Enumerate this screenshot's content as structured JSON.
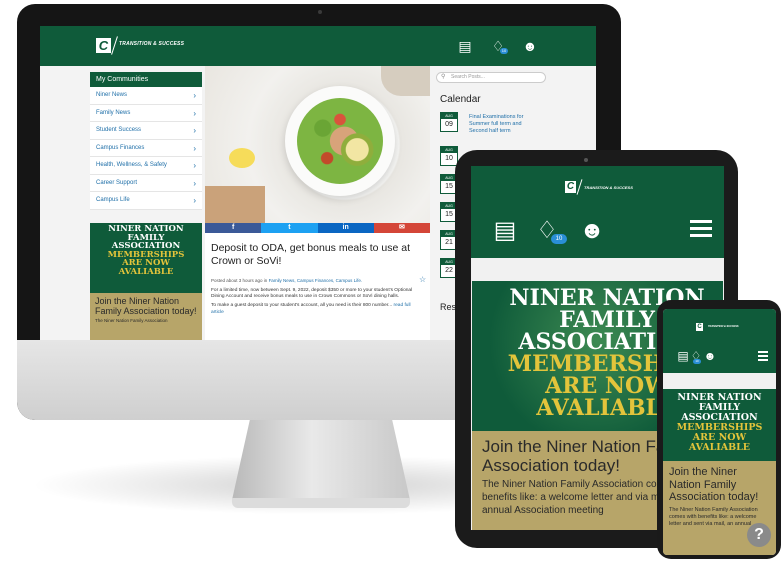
{
  "brand": {
    "logo_letter": "C",
    "logo_text": "TRANSITION & SUCCESS",
    "green": "#0f5b3a",
    "gold": "#e3c43b",
    "tan": "#b7a569"
  },
  "desktop": {
    "header_icons": [
      "newspaper-icon",
      "bell-icon",
      "user-icon"
    ],
    "notification_count": "10",
    "sidebar": {
      "title": "My Communities",
      "items": [
        {
          "label": "Niner News"
        },
        {
          "label": "Family News"
        },
        {
          "label": "Student Success"
        },
        {
          "label": "Campus Finances"
        },
        {
          "label": "Health, Wellness, & Safety"
        },
        {
          "label": "Career Support"
        },
        {
          "label": "Campus Life"
        }
      ]
    },
    "promo": {
      "line1": "NINER NATION",
      "line2": "FAMILY",
      "line3": "ASSOCIATION",
      "line4": "MEMBERSHIPS",
      "line5": "ARE NOW",
      "line6": "AVALIABLE",
      "heading": "Join the Niner Nation Family Association today!",
      "body": "The Niner Nation Family Association"
    },
    "article": {
      "share": {
        "facebook": "f",
        "twitter": "t",
        "linkedin": "in",
        "email": "✉"
      },
      "title": "Deposit to ODA, get bonus meals to use at Crown or SoVi!",
      "meta_prefix": "Posted about 3 hours ago in",
      "meta_links": "Family News, Campus Finances, Campus Life.",
      "para1": "For a limited time, now between Sept. 9, 2022, deposit $350 or more to your student's Optional Dining Account and receive bonus meals to use in Crown Commons or SoVi dining halls.",
      "para2_text": "To make a guest deposit to your student's account, all you need is their 800 number...",
      "para2_link": "read full article"
    },
    "search": {
      "placeholder": "Search Posts..."
    },
    "calendar": {
      "title": "Calendar",
      "entries": [
        {
          "month": "AUG",
          "day": "09",
          "text": "Final Examinations for Summer full term and Second half term"
        },
        {
          "month": "AUG",
          "day": "10"
        },
        {
          "month": "AUG",
          "day": "15"
        },
        {
          "month": "AUG",
          "day": "15"
        },
        {
          "month": "AUG",
          "day": "21"
        },
        {
          "month": "AUG",
          "day": "22"
        }
      ],
      "resources_label": "Res"
    }
  },
  "tablet": {
    "notification_count": "10",
    "promo": {
      "line1": "NINER NATION",
      "line2": "FAMILY",
      "line3": "ASSOCIATION",
      "line4": "MEMBERSHIPS",
      "line5": "ARE NOW",
      "line6": "AVALIABLE",
      "heading": "Join the Niner Nation Family Association today!",
      "body": "The Niner Nation Family Association comes with benefits like: a welcome letter and via mail, an annual Association meeting"
    }
  },
  "phone": {
    "notification_count": "10",
    "promo": {
      "line1": "NINER NATION",
      "line2": "FAMILY",
      "line3": "ASSOCIATION",
      "line4": "MEMBERSHIPS",
      "line5": "ARE NOW",
      "line6": "AVALIABLE",
      "heading": "Join the Niner Nation Family Association today!",
      "body": "The Niner Nation Family Association comes with benefits like: a welcome letter and sent via mail, an annual"
    },
    "help_label": "?"
  }
}
